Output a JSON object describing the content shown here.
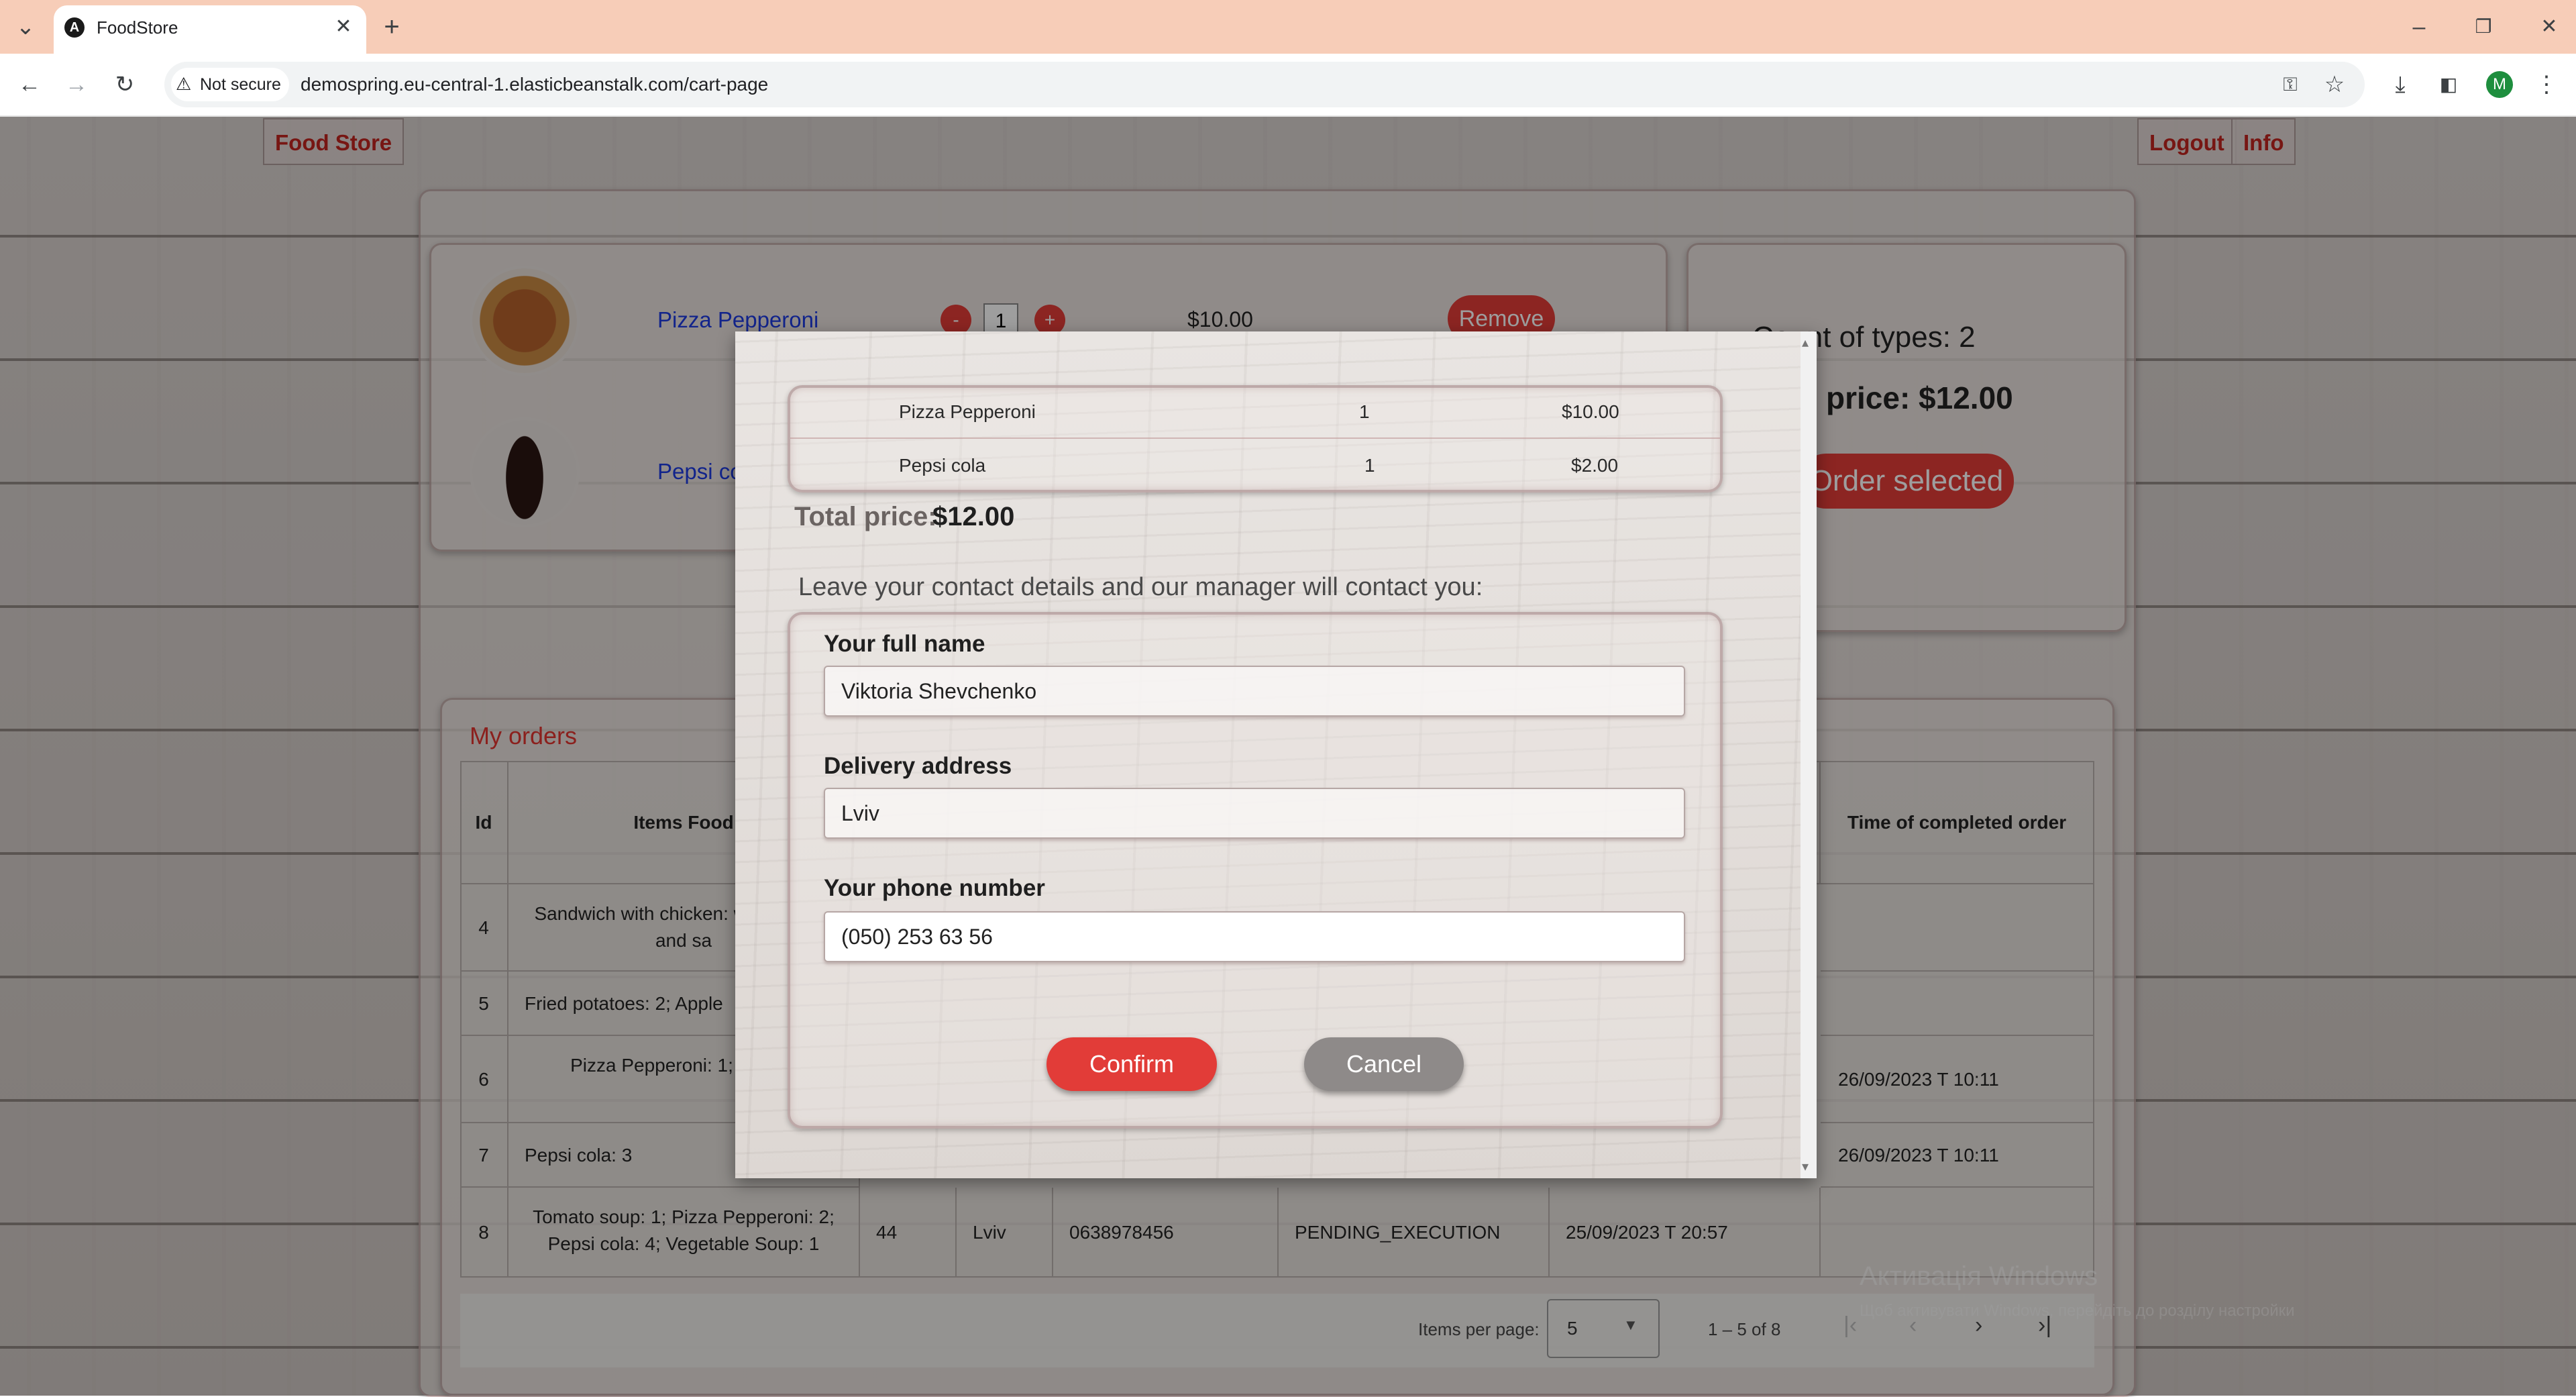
{
  "browser": {
    "tab_title": "FoodStore",
    "security": "Not secure",
    "url": "demospring.eu-central-1.elasticbeanstalk.com/cart-page",
    "profile_initial": "M"
  },
  "nav": {
    "brand": "Food Store",
    "logout": "Logout",
    "info": "Info"
  },
  "cart": {
    "items": [
      {
        "name": "Pizza Pepperoni",
        "qty": "1",
        "price": "$10.00",
        "remove": "Remove"
      },
      {
        "name": "Pepsi co"
      }
    ],
    "minus": "-",
    "plus": "+",
    "summary": {
      "count": "Count of types: 2",
      "total": "price: $12.00",
      "order_btn": "Order selected"
    }
  },
  "orders": {
    "title": "My orders",
    "headers": [
      "Id",
      "Items Food",
      "Time of completed order"
    ],
    "rows": [
      {
        "id": "4",
        "items": "Sandwich with chicken: with cheese and sa",
        "c1": "",
        "c2": "",
        "c3": "",
        "c4": "",
        "c5": "",
        "time": ""
      },
      {
        "id": "5",
        "items": "Fried potatoes: 2; Apple",
        "c1": "",
        "c2": "",
        "c3": "",
        "c4": "",
        "c5": "",
        "time": ""
      },
      {
        "id": "6",
        "items": "Pizza Pepperoni: 1; Vege 1",
        "c1": "",
        "c2": "",
        "c3": "",
        "c4": "",
        "c5": "",
        "time": "26/09/2023 T 10:11"
      },
      {
        "id": "7",
        "items": "Pepsi cola: 3",
        "c1": "",
        "c2": "",
        "c3": "",
        "c4": "",
        "c5": "",
        "time": "26/09/2023 T 10:11"
      },
      {
        "id": "8",
        "items": "Tomato soup: 1; Pizza Pepperoni: 2; Pepsi cola: 4; Vegetable Soup: 1",
        "c1": "44",
        "c2": "Lviv",
        "c3": "0638978456",
        "c4": "PENDING_EXECUTION",
        "c5": "25/09/2023 T 20:57",
        "time": ""
      }
    ],
    "paginator": {
      "label": "Items per page:",
      "size": "5",
      "range": "1 – 5 of 8"
    }
  },
  "watermark": {
    "line1": "Активація Windows",
    "line2": "Щоб активувати Windows, перейдіть до розділу настройки"
  },
  "modal": {
    "items": [
      {
        "name": "Pizza Pepperoni",
        "qty": "1",
        "price": "$10.00"
      },
      {
        "name": "Pepsi cola",
        "qty": "1",
        "price": "$2.00"
      }
    ],
    "total_label": "Total price:",
    "total_value": "$12.00",
    "contact_prompt": "Leave your contact details and our manager will contact you:",
    "fields": {
      "name_label": "Your full name",
      "name_value": "Viktoria Shevchenko",
      "address_label": "Delivery address",
      "address_value": "Lviv",
      "phone_label": "Your phone number",
      "phone_value": "(050) 253 63 56"
    },
    "confirm": "Confirm",
    "cancel": "Cancel"
  }
}
